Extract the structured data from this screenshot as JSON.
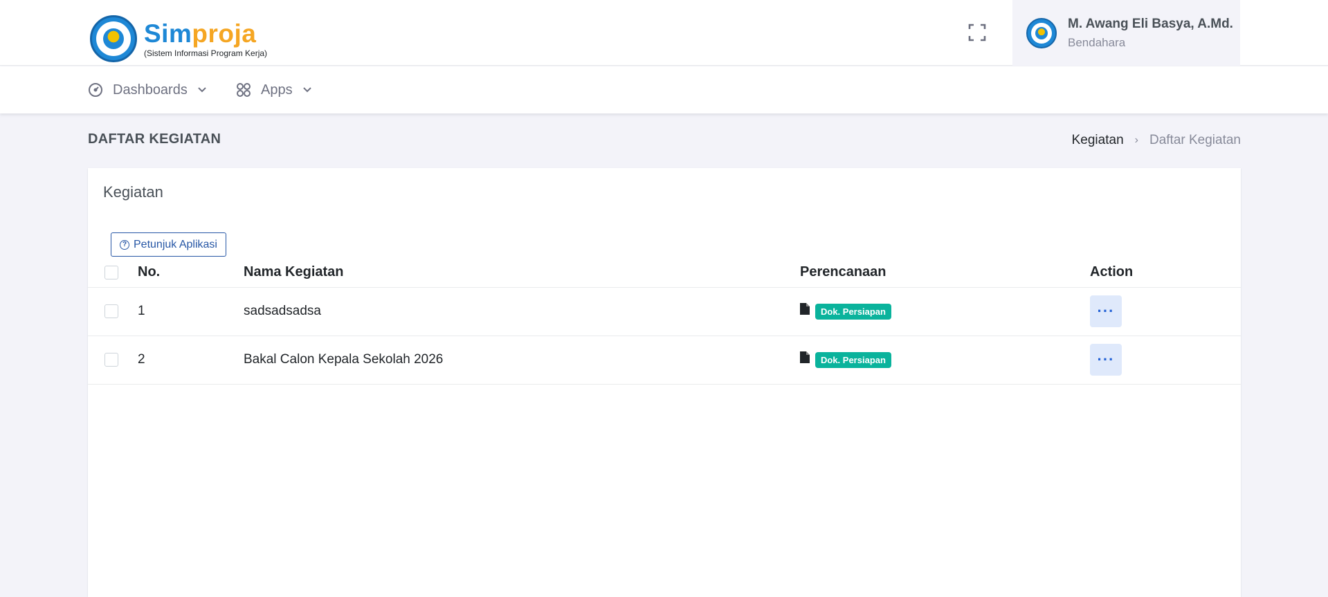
{
  "header": {
    "logo_title_a": "Sim",
    "logo_title_b": "proja",
    "logo_subtitle": "(Sistem Informasi Program Kerja)",
    "user_name": "M. Awang Eli Basya, A.Md.",
    "user_role": "Bendahara"
  },
  "nav": {
    "items": [
      {
        "label": "Dashboards",
        "icon": "speedometer-icon"
      },
      {
        "label": "Apps",
        "icon": "grid-icon"
      }
    ]
  },
  "page": {
    "title": "DAFTAR KEGIATAN",
    "breadcrumb": [
      "Kegiatan",
      "Daftar Kegiatan"
    ]
  },
  "card": {
    "title": "Kegiatan",
    "help_button": "Petunjuk Aplikasi",
    "columns": [
      "No.",
      "Nama Kegiatan",
      "Perencanaan",
      "Action"
    ],
    "rows": [
      {
        "no": "1",
        "name": "sadsadsadsa",
        "badge": "Dok. Persiapan",
        "action": "···"
      },
      {
        "no": "2",
        "name": "Bakal Calon Kepala Sekolah 2026",
        "badge": "Dok. Persiapan",
        "action": "···"
      }
    ]
  },
  "colors": {
    "primary": "#2656a5",
    "logo_blue": "#1e88d6",
    "logo_orange": "#f5a623",
    "badge_green": "#0ab39c",
    "page_bg": "#f3f3f9"
  }
}
